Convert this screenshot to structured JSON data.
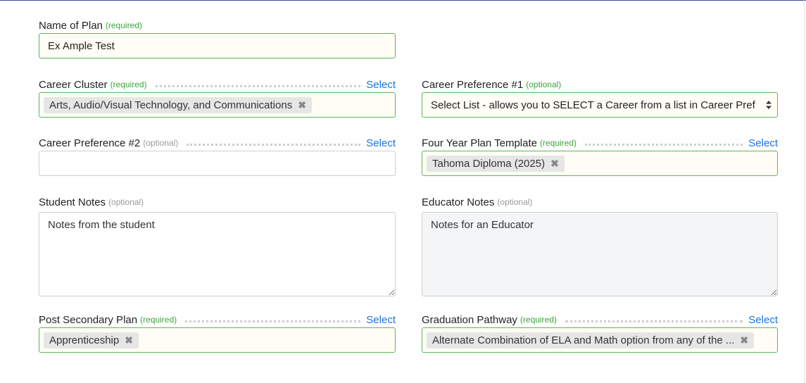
{
  "name_of_plan": {
    "label": "Name of Plan",
    "hint": "(required)",
    "value": "Ex Ample Test"
  },
  "career_cluster": {
    "label": "Career Cluster",
    "hint": "(required)",
    "select_label": "Select",
    "chip": "Arts, Audio/Visual Technology, and Communications"
  },
  "career_pref_1": {
    "label": "Career Preference #1",
    "hint": "(optional)",
    "selected": "Select List - allows you to SELECT a Career from a list in Career Pref"
  },
  "career_pref_2": {
    "label": "Career Preference #2",
    "hint": "(optional)",
    "select_label": "Select",
    "value": ""
  },
  "four_year_plan": {
    "label": "Four Year Plan Template",
    "hint": "(required)",
    "select_label": "Select",
    "chip": "Tahoma Diploma (2025)"
  },
  "student_notes": {
    "label": "Student Notes",
    "hint": "(optional)",
    "value": "Notes from the student"
  },
  "educator_notes": {
    "label": "Educator Notes",
    "hint": "(optional)",
    "value": "Notes for an Educator"
  },
  "post_secondary": {
    "label": "Post Secondary Plan",
    "hint": "(required)",
    "select_label": "Select",
    "chip": "Apprenticeship"
  },
  "graduation_pathway": {
    "label": "Graduation Pathway",
    "hint": "(required)",
    "select_label": "Select",
    "chip": "Alternate Combination of ELA and Math option from any of the ..."
  },
  "colors": {
    "required": "#3aa53a",
    "optional": "#999999",
    "link": "#1a73e8",
    "valid_border": "#5cb85c"
  }
}
